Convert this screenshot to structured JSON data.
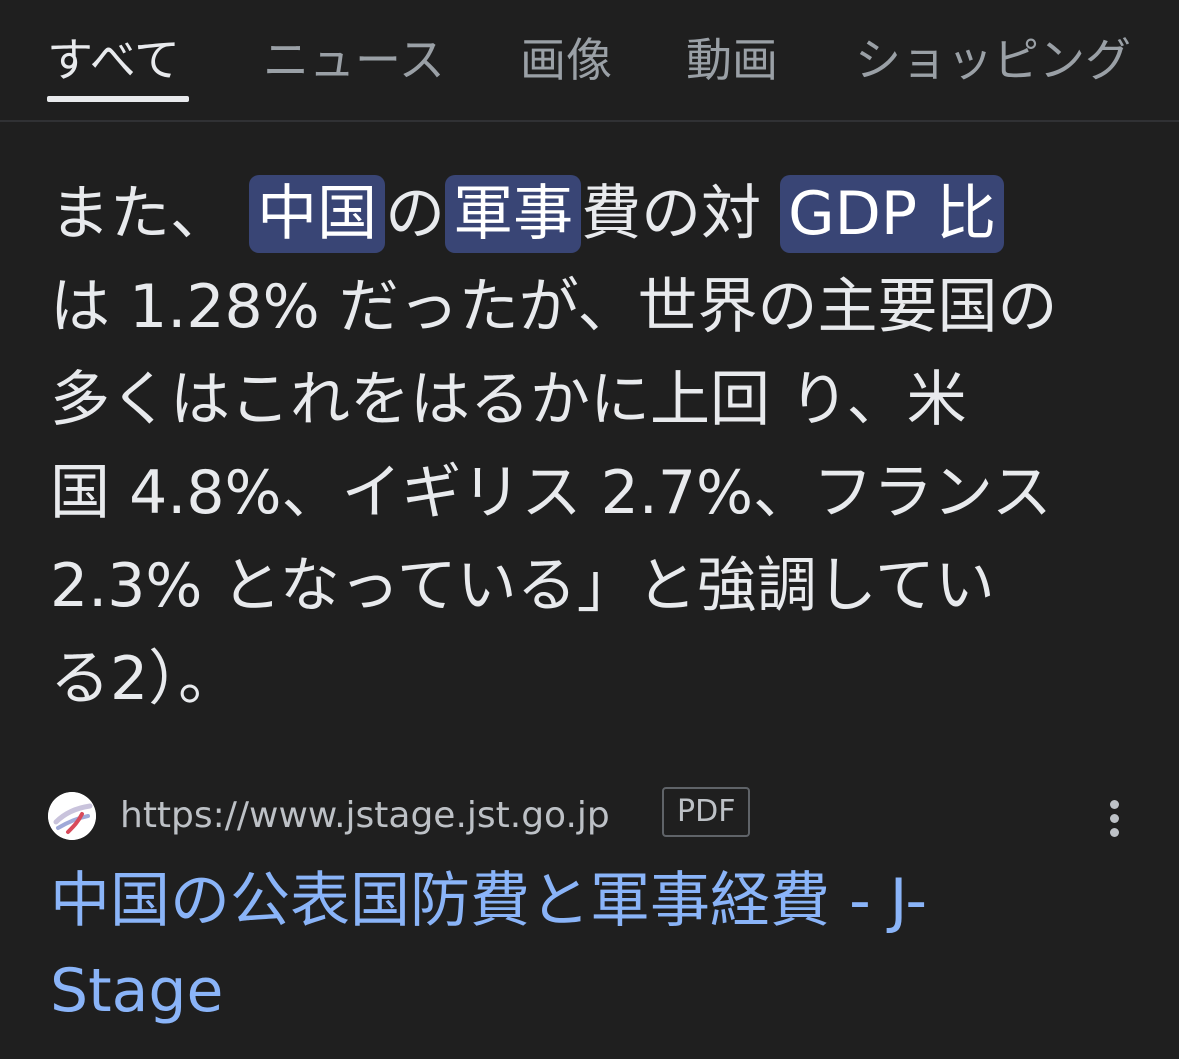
{
  "tabs": [
    {
      "label": "すべて",
      "active": true
    },
    {
      "label": "ニュース",
      "active": false
    },
    {
      "label": "画像",
      "active": false
    },
    {
      "label": "動画",
      "active": false
    },
    {
      "label": "ショッピング",
      "active": false
    }
  ],
  "snippet": {
    "line1": {
      "t1": "また、 ",
      "h1": "中国",
      "t2": "の",
      "h2": "軍事",
      "t3": "費の対 ",
      "h3": "GDP 比"
    },
    "line2": "は 1.28% だったが、世界の主要国の",
    "line3": "多くはこれをはるかに上回 り、米",
    "line4": "国 4.8%、イギリス 2.7%、フランス",
    "line5": "2.3% となっている」と強調してい",
    "line6": "る2）。"
  },
  "result": {
    "url": "https://www.jstage.jst.go.jp",
    "badge": "PDF",
    "title_line1": "中国の公表国防費と軍事経費 - J-",
    "title_line2": "Stage",
    "favicon": "jstage-favicon-icon",
    "menu_icon": "more-vert-icon"
  },
  "colors": {
    "background": "#1f1f1f",
    "text": "#e8eaed",
    "muted": "#9aa0a6",
    "highlight_bg": "#394575",
    "link": "#8ab4f8"
  }
}
